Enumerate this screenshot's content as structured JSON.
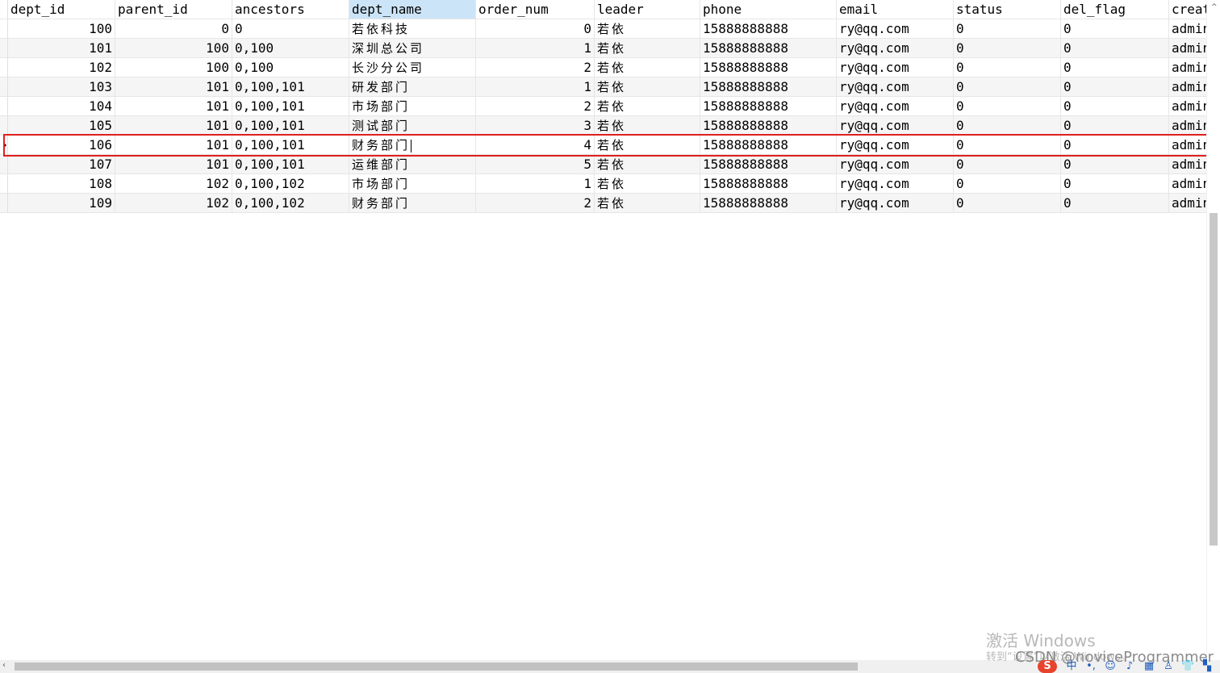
{
  "columns": [
    {
      "key": "dept_id",
      "label": "dept_id",
      "align": "right"
    },
    {
      "key": "parent_id",
      "label": "parent_id",
      "align": "right"
    },
    {
      "key": "ancestors",
      "label": "ancestors",
      "align": "left"
    },
    {
      "key": "dept_name",
      "label": "dept_name",
      "align": "left",
      "cjk": true
    },
    {
      "key": "order_num",
      "label": "order_num",
      "align": "right"
    },
    {
      "key": "leader",
      "label": "leader",
      "align": "left",
      "cjk": true
    },
    {
      "key": "phone",
      "label": "phone",
      "align": "left"
    },
    {
      "key": "email",
      "label": "email",
      "align": "left"
    },
    {
      "key": "status",
      "label": "status",
      "align": "left"
    },
    {
      "key": "del_flag",
      "label": "del_flag",
      "align": "left"
    },
    {
      "key": "create_by",
      "label": "creat",
      "align": "left"
    }
  ],
  "sorted_column": "dept_name",
  "rows": [
    {
      "dept_id": "100",
      "parent_id": "0",
      "ancestors": "0",
      "dept_name": "若依科技",
      "order_num": "0",
      "leader": "若依",
      "phone": "15888888888",
      "email": "ry@qq.com",
      "status": "0",
      "del_flag": "0",
      "create_by": "admin"
    },
    {
      "dept_id": "101",
      "parent_id": "100",
      "ancestors": "0,100",
      "dept_name": "深圳总公司",
      "order_num": "1",
      "leader": "若依",
      "phone": "15888888888",
      "email": "ry@qq.com",
      "status": "0",
      "del_flag": "0",
      "create_by": "admin"
    },
    {
      "dept_id": "102",
      "parent_id": "100",
      "ancestors": "0,100",
      "dept_name": "长沙分公司",
      "order_num": "2",
      "leader": "若依",
      "phone": "15888888888",
      "email": "ry@qq.com",
      "status": "0",
      "del_flag": "0",
      "create_by": "admin"
    },
    {
      "dept_id": "103",
      "parent_id": "101",
      "ancestors": "0,100,101",
      "dept_name": "研发部门",
      "order_num": "1",
      "leader": "若依",
      "phone": "15888888888",
      "email": "ry@qq.com",
      "status": "0",
      "del_flag": "0",
      "create_by": "admin"
    },
    {
      "dept_id": "104",
      "parent_id": "101",
      "ancestors": "0,100,101",
      "dept_name": "市场部门",
      "order_num": "2",
      "leader": "若依",
      "phone": "15888888888",
      "email": "ry@qq.com",
      "status": "0",
      "del_flag": "0",
      "create_by": "admin"
    },
    {
      "dept_id": "105",
      "parent_id": "101",
      "ancestors": "0,100,101",
      "dept_name": "测试部门",
      "order_num": "3",
      "leader": "若依",
      "phone": "15888888888",
      "email": "ry@qq.com",
      "status": "0",
      "del_flag": "0",
      "create_by": "admin"
    },
    {
      "dept_id": "106",
      "parent_id": "101",
      "ancestors": "0,100,101",
      "dept_name": "财务部门",
      "order_num": "4",
      "leader": "若依",
      "phone": "15888888888",
      "email": "ry@qq.com",
      "status": "0",
      "del_flag": "0",
      "create_by": "admin"
    },
    {
      "dept_id": "107",
      "parent_id": "101",
      "ancestors": "0,100,101",
      "dept_name": "运维部门",
      "order_num": "5",
      "leader": "若依",
      "phone": "15888888888",
      "email": "ry@qq.com",
      "status": "0",
      "del_flag": "0",
      "create_by": "admin"
    },
    {
      "dept_id": "108",
      "parent_id": "102",
      "ancestors": "0,100,102",
      "dept_name": "市场部门",
      "order_num": "1",
      "leader": "若依",
      "phone": "15888888888",
      "email": "ry@qq.com",
      "status": "0",
      "del_flag": "0",
      "create_by": "admin"
    },
    {
      "dept_id": "109",
      "parent_id": "102",
      "ancestors": "0,100,102",
      "dept_name": "财务部门",
      "order_num": "2",
      "leader": "若依",
      "phone": "15888888888",
      "email": "ry@qq.com",
      "status": "0",
      "del_flag": "0",
      "create_by": "admin"
    }
  ],
  "current_row_index": 6,
  "editing_column": "dept_name",
  "colors": {
    "highlight_border": "#e02020",
    "alt_row": "#f5f5f5",
    "sorted_header": "#cce4f7"
  },
  "watermark": {
    "line1": "激活 Windows",
    "line2": "转到“设置”以激活 Windows。"
  },
  "csdn_label": "CSDN @noviceProgrammer",
  "tray": {
    "sogou_label": "S",
    "items": [
      {
        "name": "ime-mode-icon",
        "glyph": "中"
      },
      {
        "name": "punctuation-icon",
        "glyph": "•,"
      },
      {
        "name": "emoji-icon",
        "glyph": "☺"
      },
      {
        "name": "microphone-icon",
        "glyph": "♪"
      },
      {
        "name": "keyboard-icon",
        "glyph": "▦"
      },
      {
        "name": "user-icon",
        "glyph": "♙"
      },
      {
        "name": "skin-icon",
        "glyph": "👕"
      },
      {
        "name": "toolbox-icon",
        "glyph": "▚"
      }
    ]
  }
}
